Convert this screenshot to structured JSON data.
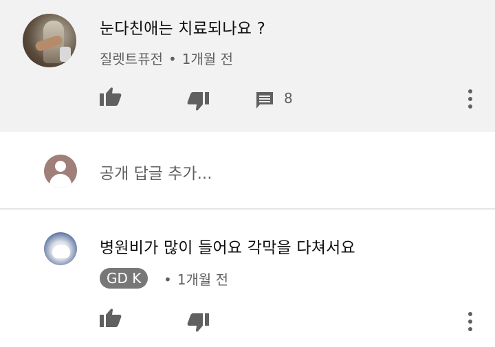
{
  "comments": [
    {
      "text": "눈다친애는 치료되나요 ?",
      "author": "질렛트퓨전",
      "separator": "•",
      "time": "1개월 전",
      "reply_count": "8",
      "icons": {
        "like": "thumbs-up-icon",
        "dislike": "thumbs-down-icon",
        "reply": "comment-icon",
        "more": "more-vert-icon"
      }
    },
    {
      "text": "병원비가 많이 들어요 각막을 다쳐서요",
      "author": "GD K",
      "separator": "•",
      "time": "1개월 전",
      "icons": {
        "like": "thumbs-up-icon",
        "dislike": "thumbs-down-icon",
        "more": "more-vert-icon"
      }
    }
  ],
  "add_reply": {
    "placeholder": "공개 답글 추가..."
  },
  "colors": {
    "highlight_bg": "#f2f2f2",
    "secondary_text": "#606060",
    "icon": "#606060",
    "badge_bg": "#777777"
  }
}
